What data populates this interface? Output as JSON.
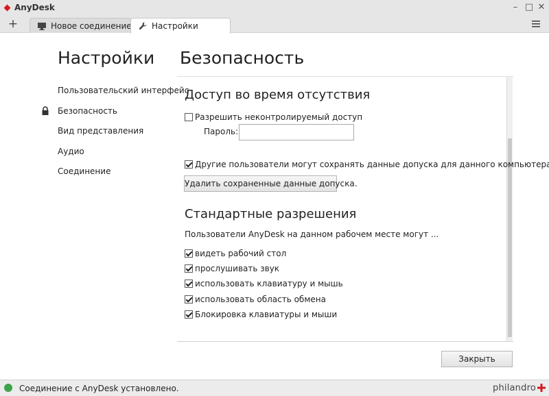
{
  "app": {
    "title": "AnyDesk"
  },
  "tabs": [
    {
      "label": "Новое соединение",
      "icon": "monitor-icon"
    },
    {
      "label": "Настройки",
      "icon": "wrench-icon"
    }
  ],
  "sidebar": {
    "title": "Настройки",
    "items": [
      {
        "label": "Пользовательский интерфейс"
      },
      {
        "label": "Безопасность",
        "active": true,
        "icon": "lock-icon"
      },
      {
        "label": "Вид представления"
      },
      {
        "label": "Аудио"
      },
      {
        "label": "Соединение"
      }
    ]
  },
  "main": {
    "title": "Безопасность",
    "unattended": {
      "title": "Доступ во время отсутствия",
      "allow_label": "Разрешить неконтролируемый доступ",
      "allow_checked": false,
      "password_label": "Пароль:",
      "password_value": "",
      "save_credentials_label": "Другие пользователи могут сохранять данные допуска для данного компьютера",
      "save_credentials_checked": true,
      "delete_button": "Удалить сохраненные данные допуска."
    },
    "permissions": {
      "title": "Стандартные разрешения",
      "intro": "Пользователи AnyDesk на данном рабочем месте могут ...",
      "items": [
        {
          "label": "видеть рабочий стол",
          "checked": true
        },
        {
          "label": "прослушивать звук",
          "checked": true
        },
        {
          "label": "использовать клавиатуру и мышь",
          "checked": true
        },
        {
          "label": "использовать область обмена",
          "checked": true
        },
        {
          "label": "Блокировка клавиатуры и мыши",
          "checked": true
        }
      ]
    },
    "close_button": "Закрыть"
  },
  "status": {
    "text": "Соединение с AnyDesk установлено.",
    "brand": "philandro"
  },
  "colors": {
    "accent": "#d71920",
    "status_ok": "#3da34d"
  }
}
